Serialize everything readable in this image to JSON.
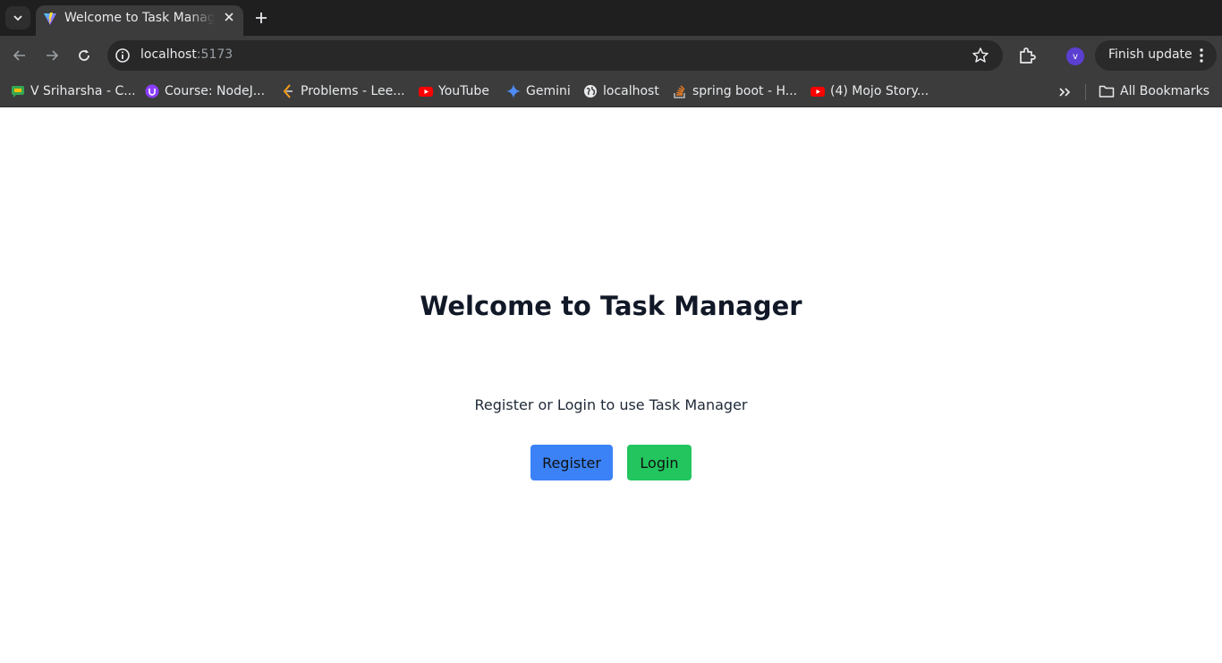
{
  "browser": {
    "tab": {
      "title": "Welcome to Task Manager"
    },
    "address_bar": {
      "host": "localhost",
      "port": ":5173"
    },
    "profile_initial": "v",
    "finish_update_label": "Finish update",
    "bookmarks": [
      {
        "label": "V Sriharsha - C...",
        "icon": "chat-icon"
      },
      {
        "label": "Course: NodeJ...",
        "icon": "course-icon"
      },
      {
        "label": "Problems - Lee...",
        "icon": "leetcode-icon"
      },
      {
        "label": "YouTube",
        "icon": "youtube-icon"
      },
      {
        "label": "Gemini",
        "icon": "gemini-icon"
      },
      {
        "label": "localhost",
        "icon": "globe-icon"
      },
      {
        "label": "spring boot - H...",
        "icon": "stackoverflow-icon"
      },
      {
        "label": "(4) Mojo Story...",
        "icon": "youtube-icon"
      }
    ],
    "all_bookmarks_label": "All Bookmarks"
  },
  "page": {
    "title": "Welcome to Task Manager",
    "subtitle": "Register or Login to use Task Manager",
    "register_label": "Register",
    "login_label": "Login"
  },
  "colors": {
    "register_button": "#3b82f6",
    "login_button": "#22c55e",
    "title_text": "#111827"
  }
}
